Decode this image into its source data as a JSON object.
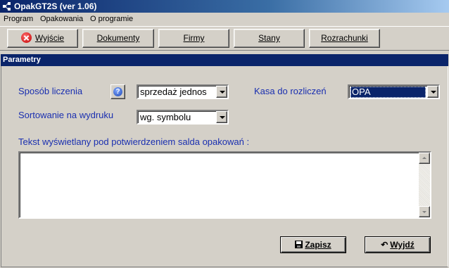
{
  "window": {
    "title": "OpakGT2S (ver 1.06)"
  },
  "menu": [
    "Program",
    "Opakowania",
    "O programie"
  ],
  "toolbar": {
    "exit_label": "Wyjście",
    "documents_label": "Dokumenty",
    "companies_label": "Firmy",
    "states_label": "Stany",
    "settlements_label": "Rozrachunki"
  },
  "panel": {
    "title": "Parametry",
    "calc_method_label": "Sposób liczenia",
    "help_symbol": "?",
    "calc_method_value": "sprzedaż jednos",
    "sort_label": "Sortowanie na wydruku",
    "sort_value": "wg. symbolu",
    "cash_label": "Kasa do rozliczeń",
    "cash_value": "OPA",
    "text_label": "Tekst wyświetlany pod potwierdzeniem salda opakowań :",
    "text_value": ""
  },
  "buttons": {
    "save_label": "Zapisz",
    "exit_label": "Wyjdź"
  },
  "colors": {
    "title_bar": "#0a246a",
    "label_blue": "#1a2fb0",
    "selection": "#0a246a",
    "face": "#d4d0c8"
  }
}
